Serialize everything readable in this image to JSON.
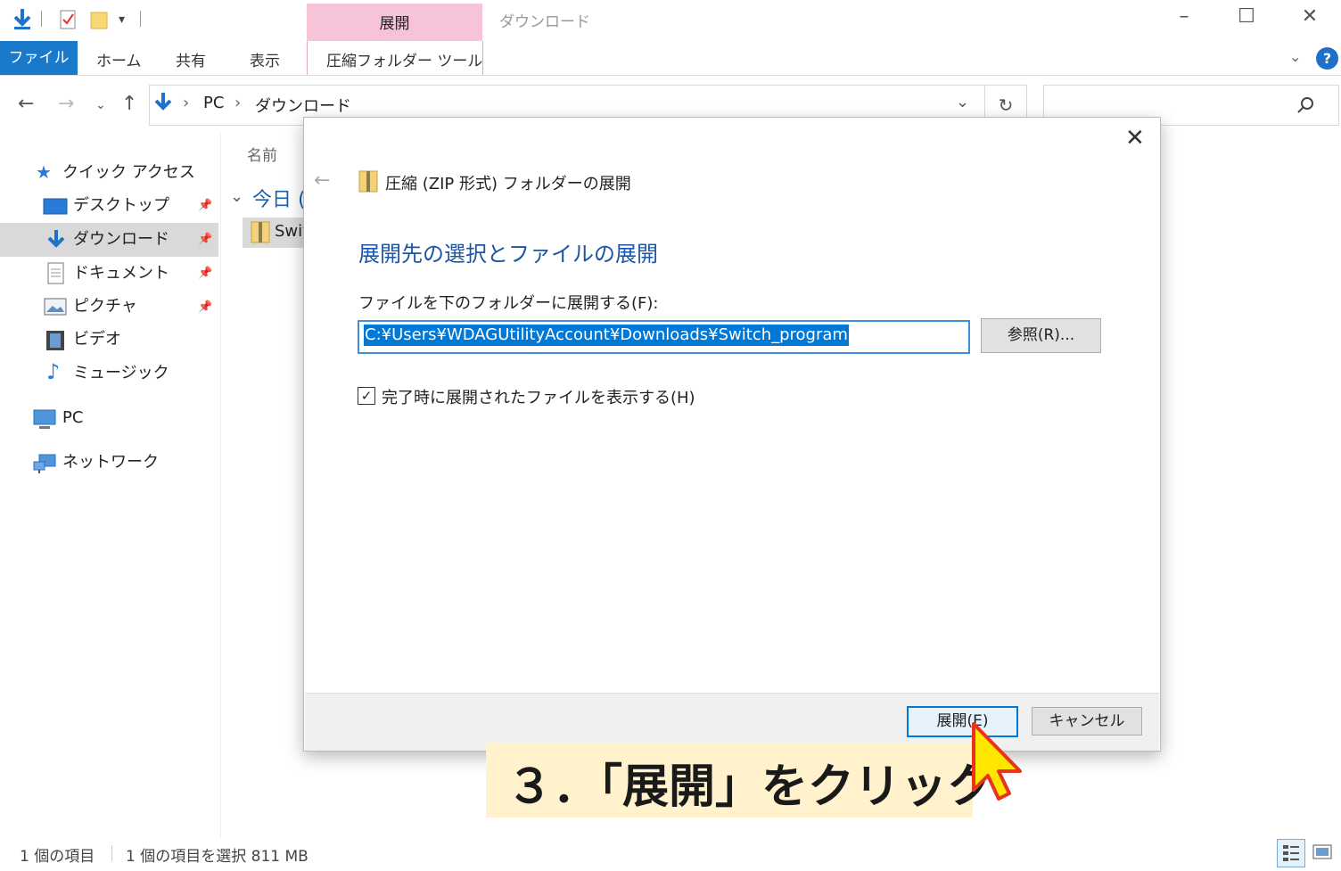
{
  "window": {
    "title": "ダウンロード",
    "context_tab_label": "展開",
    "minimize": "–",
    "maximize": "☐",
    "close": "✕"
  },
  "ribbon": {
    "tabs": [
      "ファイル",
      "ホーム",
      "共有",
      "表示",
      "圧縮フォルダー ツール"
    ]
  },
  "address": {
    "segments": [
      "PC",
      "ダウンロード"
    ],
    "separator": "›"
  },
  "nav": {
    "quick_access": "クイック アクセス",
    "items": [
      "デスクトップ",
      "ダウンロード",
      "ドキュメント",
      "ピクチャ",
      "ビデオ",
      "ミュージック"
    ],
    "pc": "PC",
    "network": "ネットワーク"
  },
  "files": {
    "column_name": "名前",
    "group": "今日 (",
    "item": "Swit"
  },
  "status": {
    "count": "1 個の項目",
    "selected": "1 個の項目を選択  811 MB"
  },
  "dialog": {
    "title": "圧縮 (ZIP 形式) フォルダーの展開",
    "heading": "展開先の選択とファイルの展開",
    "field_label": "ファイルを下のフォルダーに展開する(F):",
    "path_value": "C:¥Users¥WDAGUtilityAccount¥Downloads¥Switch_program",
    "browse_label": "参照(R)...",
    "checkbox_label": "完了時に展開されたファイルを表示する(H)",
    "checkbox_checked": true,
    "extract_label": "展開(E)",
    "cancel_label": "キャンセル"
  },
  "annotation": {
    "text": "３．「展開」をクリック"
  },
  "colors": {
    "accent": "#1979ca",
    "context_tab": "#f7c3d9",
    "heading": "#1b56a6",
    "selection": "#0078d7",
    "callout": "#fff2cc"
  }
}
